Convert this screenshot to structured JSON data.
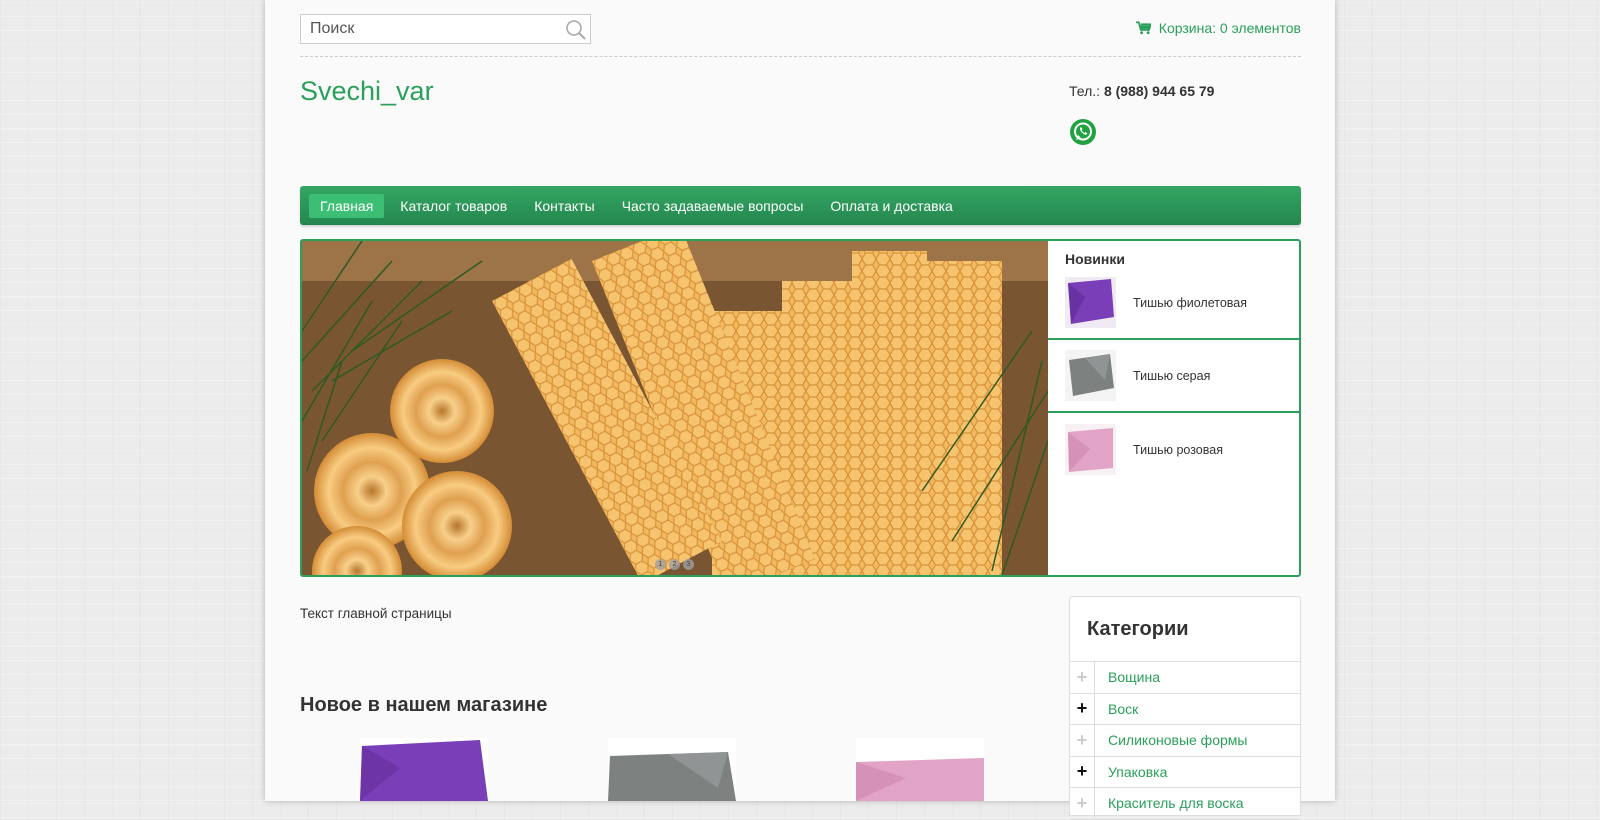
{
  "search": {
    "placeholder": "Поиск"
  },
  "cart": {
    "label": "Корзина: 0 элементов"
  },
  "brand": {
    "name": "Svechi_var"
  },
  "contact": {
    "phone_label": "Тел.:",
    "phone": "8 (988) 944 65 79"
  },
  "nav": {
    "items": [
      {
        "label": "Главная",
        "active": true
      },
      {
        "label": "Каталог товаров"
      },
      {
        "label": "Контакты"
      },
      {
        "label": "Часто задаваемые вопросы"
      },
      {
        "label": "Оплата и доставка"
      }
    ]
  },
  "slider": {
    "dots": [
      "1",
      "2",
      "3"
    ]
  },
  "new_items": {
    "title": "Новинки",
    "items": [
      {
        "name": "Тишью фиолетовая",
        "color": "#7a3fb8"
      },
      {
        "name": "Тишью серая",
        "color": "#7d8180"
      },
      {
        "name": "Тишью розовая",
        "color": "#e2a4c6"
      }
    ]
  },
  "main": {
    "text": "Текст главной страницы",
    "section_title": "Новое в нашем магазине"
  },
  "categories": {
    "title": "Категории",
    "items": [
      {
        "label": "Вощина",
        "toggle": "+",
        "dim": true
      },
      {
        "label": "Воск",
        "toggle": "+",
        "dim": false
      },
      {
        "label": "Силиконовые формы",
        "toggle": "+",
        "dim": true
      },
      {
        "label": "Упаковка",
        "toggle": "+",
        "dim": false
      },
      {
        "label": "Краситель для воска",
        "toggle": "+",
        "dim": true
      }
    ]
  },
  "colors": {
    "accent": "#2aa05a",
    "nav_bg": "#2a9857"
  }
}
